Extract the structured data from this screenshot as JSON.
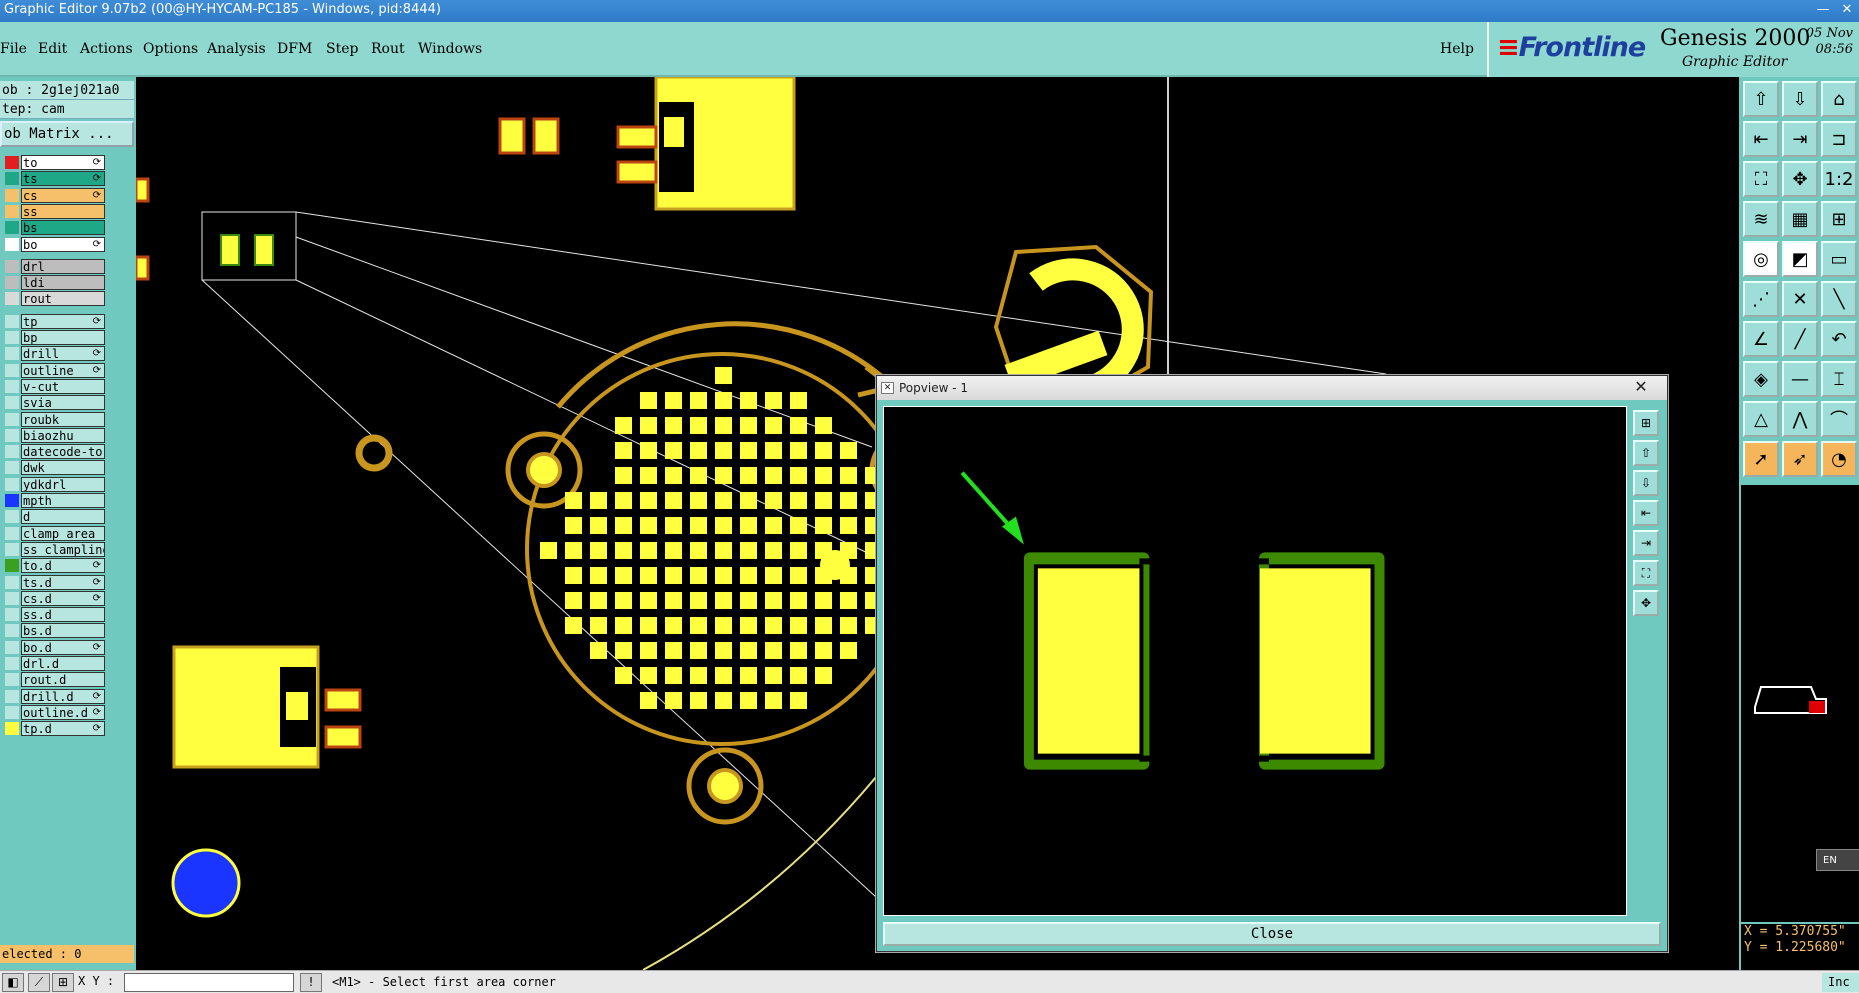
{
  "window": {
    "title": "Graphic Editor 9.07b2 (00@HY-HYCAM-PC185 - Windows, pid:8444)",
    "minimize_label": "—",
    "close_label": "✕"
  },
  "menu": {
    "items": [
      "File",
      "Edit",
      "Actions",
      "Options",
      "Analysis",
      "DFM",
      "Step",
      "Rout",
      "Windows"
    ],
    "help": "Help"
  },
  "brand": {
    "logo": "Frontline",
    "product": "Genesis 2000",
    "subtitle": "Graphic Editor",
    "date": "05 Nov",
    "time": "08:56"
  },
  "job": {
    "job_label": "ob : 2g1ej021a0",
    "step_label": "tep: cam",
    "matrix_button": "ob Matrix ..."
  },
  "layers": [
    {
      "name": "to",
      "bg": "#ffffff",
      "swatch": "#e02020",
      "mark": "⟳"
    },
    {
      "name": "ts",
      "bg": "#1fa888",
      "swatch": "#1fa888",
      "mark": "⟳"
    },
    {
      "name": "cs",
      "bg": "#f6c06a",
      "swatch": "#f6c06a",
      "mark": "⟳"
    },
    {
      "name": "ss",
      "bg": "#f6c06a",
      "swatch": "#f6c06a",
      "mark": ""
    },
    {
      "name": "bs",
      "bg": "#1fa888",
      "swatch": "#1fa888",
      "mark": ""
    },
    {
      "name": "bo",
      "bg": "#ffffff",
      "swatch": "#ffffff",
      "mark": "⟳"
    },
    {
      "name": "drl",
      "bg": "#bdbdbd",
      "swatch": "#bdbdbd",
      "mark": ""
    },
    {
      "name": "ldi",
      "bg": "#bdbdbd",
      "swatch": "#bdbdbd",
      "mark": ""
    },
    {
      "name": "rout",
      "bg": "#d9d9d9",
      "swatch": "#d9d9d9",
      "mark": ""
    },
    {
      "name": "tp",
      "bg": "#b7e5e0",
      "swatch": "#b7e5e0",
      "mark": "⟳"
    },
    {
      "name": "bp",
      "bg": "#b7e5e0",
      "swatch": "#b7e5e0",
      "mark": ""
    },
    {
      "name": "drill",
      "bg": "#b7e5e0",
      "swatch": "#b7e5e0",
      "mark": "⟳"
    },
    {
      "name": "outline",
      "bg": "#b7e5e0",
      "swatch": "#b7e5e0",
      "mark": "⟳"
    },
    {
      "name": "v-cut",
      "bg": "#b7e5e0",
      "swatch": "#b7e5e0",
      "mark": ""
    },
    {
      "name": "svia",
      "bg": "#b7e5e0",
      "swatch": "#b7e5e0",
      "mark": ""
    },
    {
      "name": "roubk",
      "bg": "#b7e5e0",
      "swatch": "#b7e5e0",
      "mark": ""
    },
    {
      "name": "biaozhu",
      "bg": "#b7e5e0",
      "swatch": "#b7e5e0",
      "mark": ""
    },
    {
      "name": "datecode-to",
      "bg": "#b7e5e0",
      "swatch": "#b7e5e0",
      "mark": ""
    },
    {
      "name": "dwk",
      "bg": "#b7e5e0",
      "swatch": "#b7e5e0",
      "mark": ""
    },
    {
      "name": "ydkdrl",
      "bg": "#b7e5e0",
      "swatch": "#b7e5e0",
      "mark": ""
    },
    {
      "name": "mpth",
      "bg": "#b7e5e0",
      "swatch": "#1a35ff",
      "mark": ""
    },
    {
      "name": "d",
      "bg": "#b7e5e0",
      "swatch": "#b7e5e0",
      "mark": ""
    },
    {
      "name": "clamp_area",
      "bg": "#b7e5e0",
      "swatch": "#b7e5e0",
      "mark": ""
    },
    {
      "name": "ss_clampline",
      "bg": "#b7e5e0",
      "swatch": "#b7e5e0",
      "mark": ""
    },
    {
      "name": "to.d",
      "bg": "#b7e5e0",
      "swatch": "#3aa020",
      "mark": "⟳"
    },
    {
      "name": "ts.d",
      "bg": "#b7e5e0",
      "swatch": "#b7e5e0",
      "mark": "⟳"
    },
    {
      "name": "cs.d",
      "bg": "#b7e5e0",
      "swatch": "#b7e5e0",
      "mark": "⟳"
    },
    {
      "name": "ss.d",
      "bg": "#b7e5e0",
      "swatch": "#b7e5e0",
      "mark": ""
    },
    {
      "name": "bs.d",
      "bg": "#b7e5e0",
      "swatch": "#b7e5e0",
      "mark": ""
    },
    {
      "name": "bo.d",
      "bg": "#b7e5e0",
      "swatch": "#b7e5e0",
      "mark": "⟳"
    },
    {
      "name": "drl.d",
      "bg": "#b7e5e0",
      "swatch": "#b7e5e0",
      "mark": ""
    },
    {
      "name": "rout.d",
      "bg": "#b7e5e0",
      "swatch": "#b7e5e0",
      "mark": ""
    },
    {
      "name": "drill.d",
      "bg": "#b7e5e0",
      "swatch": "#b7e5e0",
      "mark": "⟳"
    },
    {
      "name": "outline.d",
      "bg": "#b7e5e0",
      "swatch": "#b7e5e0",
      "mark": "⟳"
    },
    {
      "name": "tp.d",
      "bg": "#b7e5e0",
      "swatch": "#ffff40",
      "mark": "⟳"
    }
  ],
  "selected_label": "elected : 0",
  "toolbar_icons": [
    [
      "home-up-icon",
      "⇧"
    ],
    [
      "home-down-icon",
      "⇩"
    ],
    [
      "home-icon",
      "⌂"
    ],
    [
      "step-in-icon",
      "⇤"
    ],
    [
      "step-out-icon",
      "⇥"
    ],
    [
      "snap-icon",
      "⊐"
    ],
    [
      "fit-icon",
      "⛶"
    ],
    [
      "pan-icon",
      "✥"
    ],
    [
      "ratio-icon",
      "1:2"
    ],
    [
      "measure-icon",
      "≋"
    ],
    [
      "grid-icon",
      "▦"
    ],
    [
      "net-icon",
      "⊞"
    ],
    [
      "feature-icon",
      "◎"
    ],
    [
      "slice-icon",
      "◩"
    ],
    [
      "ruler-icon",
      "▭"
    ],
    [
      "connect-icon",
      "⋰"
    ],
    [
      "cross-icon",
      "✕"
    ],
    [
      "line-icon",
      "╲"
    ],
    [
      "angle-icon",
      "∠"
    ],
    [
      "diag-icon",
      "╱"
    ],
    [
      "arc-icon",
      "↶"
    ],
    [
      "node-icon",
      "◈"
    ],
    [
      "minus-icon",
      "—"
    ],
    [
      "bracket-icon",
      "⌶"
    ],
    [
      "triangle-icon",
      "△"
    ],
    [
      "peak-icon",
      "⋀"
    ],
    [
      "arch-icon",
      "⌒"
    ],
    [
      "pointer-icon",
      "➚"
    ],
    [
      "select-icon",
      "➶"
    ],
    [
      "lasso-icon",
      "◔"
    ]
  ],
  "coords": {
    "x": "X = 5.370755\"",
    "y": "Y = 1.225680\""
  },
  "lang": "EN",
  "status": {
    "xy_label": "X Y :",
    "xy_value": "",
    "prompt": "<M1> - Select first area corner",
    "unit": "Inc"
  },
  "popview": {
    "title": "Popview - 1",
    "close_x": "✕",
    "close_button": "Close"
  }
}
